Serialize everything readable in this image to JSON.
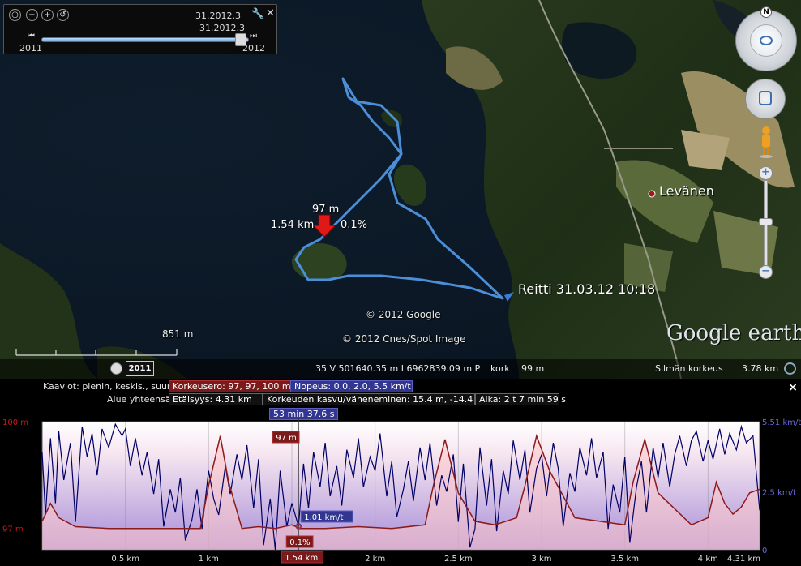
{
  "time_slider": {
    "date_top": "31.2012.3",
    "date_handle": "31.2012.3",
    "start_year": "2011",
    "end_year": "2012",
    "position": 0.94
  },
  "map": {
    "place_name": "Levänen",
    "route_label": "Reitti 31.03.12 10:18",
    "marker_elevation": "97 m",
    "marker_distance": "1.54 km",
    "marker_grade": "0.1%",
    "copyright_1": "© 2012 Google",
    "copyright_2": "© 2012 Cnes/Spot Image",
    "logo": "Google earth",
    "scale_label": "851 m",
    "compass_letter": "N"
  },
  "status_bar": {
    "year": "2011",
    "coordinates": "35 V 501640.35 m I 6962839.09 m P",
    "kork_label": "kork",
    "kork_value": "99 m",
    "eye_alt_label": "Silmän korkeus",
    "eye_alt_value": "3.78 km"
  },
  "elevation_panel": {
    "graphs_label": "Kaaviot: pienin, keskis., suurin",
    "elev_range": "Korkeusero: 97, 97, 100 m",
    "speed_range": "Nopeus: 0.0, 2.0, 5.5 km/t",
    "totals_label": "Alue yhteensä:",
    "distance": "Etäisyys: 4.31 km",
    "gain_loss": "Korkeuden kasvu/väheneminen: 15.4 m, -14.4 m",
    "time": "Aika: 2 t 7 min 59 s",
    "cursor_time": "53 min 37.6 s",
    "close_label": "×"
  },
  "chart_data": {
    "type": "line",
    "x_ticks": [
      "0.5 km",
      "1 km",
      "1.5 km",
      "2 km",
      "2.5 km",
      "3 km",
      "3.5 km",
      "4 km",
      "4.31 km"
    ],
    "xlim": [
      0,
      4.31
    ],
    "left_axis_ticks": [
      "100 m",
      "97 m"
    ],
    "left_ylim": [
      96.4,
      100
    ],
    "right_axis_ticks": [
      "5.51 km/t",
      "2.5 km/t",
      "0"
    ],
    "right_ylim": [
      0,
      5.51
    ],
    "cursor": {
      "x": 1.54,
      "x_label": "1.54 km",
      "elevation_label": "97 m",
      "speed_label": "1.01 km/t",
      "grade_label": "0.1%"
    },
    "series": [
      {
        "name": "Korkeusero",
        "color": "#8b1a1a",
        "x": [
          0,
          0.05,
          0.1,
          0.2,
          0.4,
          0.7,
          0.95,
          1.0,
          1.07,
          1.12,
          1.2,
          1.3,
          1.4,
          1.5,
          1.55,
          1.62,
          1.7,
          1.9,
          2.1,
          2.3,
          2.35,
          2.42,
          2.5,
          2.6,
          2.72,
          2.85,
          2.9,
          2.97,
          3.05,
          3.2,
          3.35,
          3.5,
          3.55,
          3.62,
          3.7,
          3.9,
          4.0,
          4.05,
          4.1,
          4.15,
          4.2,
          4.25,
          4.31
        ],
        "y": [
          97.2,
          97.7,
          97.3,
          97.05,
          97.0,
          97.0,
          97.0,
          98.2,
          99.6,
          98.3,
          97.0,
          97.05,
          97.0,
          97.1,
          97.0,
          97.0,
          97.0,
          97.05,
          97.0,
          97.1,
          98.2,
          99.5,
          98.0,
          97.2,
          97.1,
          97.3,
          98.2,
          99.6,
          98.6,
          97.3,
          97.2,
          97.1,
          98.3,
          99.5,
          98.0,
          97.1,
          97.3,
          98.3,
          97.7,
          97.4,
          97.6,
          98.0,
          98.1
        ]
      },
      {
        "name": "Nopeus",
        "color": "#000066",
        "x": [
          0,
          0.02,
          0.05,
          0.08,
          0.1,
          0.13,
          0.17,
          0.2,
          0.24,
          0.27,
          0.3,
          0.33,
          0.36,
          0.4,
          0.44,
          0.48,
          0.5,
          0.53,
          0.56,
          0.6,
          0.63,
          0.67,
          0.7,
          0.73,
          0.77,
          0.8,
          0.83,
          0.86,
          0.9,
          0.93,
          0.96,
          1.0,
          1.03,
          1.06,
          1.1,
          1.13,
          1.17,
          1.2,
          1.23,
          1.27,
          1.3,
          1.33,
          1.37,
          1.4,
          1.43,
          1.47,
          1.5,
          1.54,
          1.57,
          1.6,
          1.63,
          1.67,
          1.7,
          1.73,
          1.77,
          1.8,
          1.83,
          1.87,
          1.9,
          1.93,
          1.97,
          2.0,
          2.03,
          2.07,
          2.1,
          2.13,
          2.17,
          2.2,
          2.23,
          2.27,
          2.3,
          2.33,
          2.37,
          2.4,
          2.43,
          2.47,
          2.5,
          2.53,
          2.57,
          2.6,
          2.63,
          2.67,
          2.7,
          2.73,
          2.77,
          2.8,
          2.83,
          2.87,
          2.9,
          2.93,
          2.97,
          3.0,
          3.03,
          3.07,
          3.1,
          3.13,
          3.17,
          3.2,
          3.23,
          3.27,
          3.3,
          3.33,
          3.37,
          3.4,
          3.43,
          3.47,
          3.5,
          3.53,
          3.57,
          3.6,
          3.63,
          3.67,
          3.7,
          3.73,
          3.77,
          3.8,
          3.83,
          3.87,
          3.9,
          3.93,
          3.97,
          4.0,
          4.03,
          4.07,
          4.1,
          4.13,
          4.17,
          4.2,
          4.23,
          4.27,
          4.31
        ],
        "y": [
          4.2,
          1.5,
          4.8,
          2.0,
          5.1,
          3.0,
          4.6,
          1.2,
          5.3,
          4.0,
          5.0,
          3.2,
          5.2,
          4.4,
          5.4,
          4.9,
          5.2,
          3.6,
          4.8,
          3.2,
          4.2,
          2.4,
          3.9,
          1.0,
          2.6,
          1.6,
          3.1,
          0.4,
          1.3,
          2.6,
          0.9,
          3.4,
          2.2,
          1.5,
          3.6,
          2.4,
          4.1,
          3.0,
          4.5,
          1.8,
          3.9,
          0.2,
          2.2,
          0.0,
          3.4,
          1.0,
          2.0,
          1.01,
          3.7,
          1.8,
          4.2,
          2.7,
          4.6,
          2.3,
          3.6,
          1.9,
          4.3,
          3.1,
          4.8,
          2.7,
          4.0,
          3.4,
          5.0,
          2.3,
          3.8,
          1.4,
          2.6,
          3.8,
          2.1,
          4.4,
          3.0,
          4.6,
          1.9,
          3.2,
          2.5,
          4.1,
          1.2,
          3.7,
          0.1,
          0.9,
          4.4,
          1.9,
          3.9,
          0.8,
          3.4,
          2.4,
          4.7,
          3.0,
          4.3,
          1.6,
          3.5,
          4.1,
          2.3,
          4.6,
          3.5,
          1.0,
          3.3,
          2.5,
          4.4,
          3.2,
          4.8,
          3.1,
          4.2,
          0.9,
          2.8,
          1.6,
          4.0,
          0.3,
          2.7,
          3.8,
          1.6,
          4.4,
          3.1,
          4.6,
          2.7,
          4.1,
          4.9,
          3.6,
          4.7,
          5.1,
          3.8,
          4.7,
          3.9,
          5.2,
          4.1,
          5.0,
          4.3,
          5.3,
          4.6,
          4.9,
          1.7
        ]
      }
    ]
  }
}
